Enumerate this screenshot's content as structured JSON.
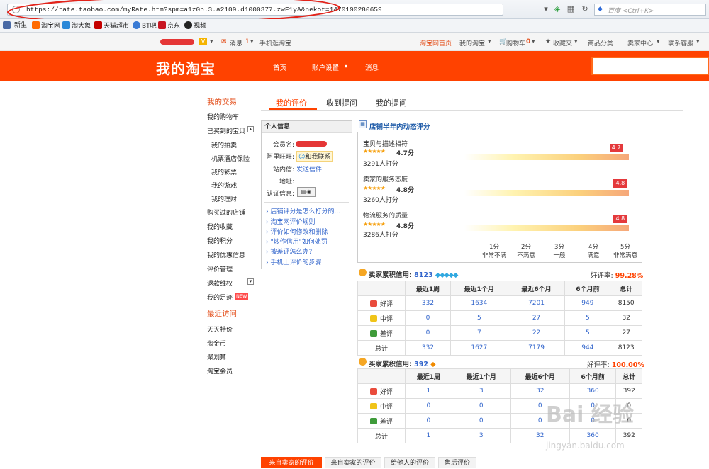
{
  "browser": {
    "url": "https://rate.taobao.com/myRate.htm?spm=a1z0b.3.a2109.d1000377.zwF1yA&nekot=1470190280659",
    "search_placeholder": "百度 <Ctrl+K>"
  },
  "bookmarks": [
    "新生",
    "淘宝网",
    "淘大象",
    "天猫超市",
    "BT吧",
    "京东",
    "视频"
  ],
  "sitenav": {
    "messages": "消息",
    "messages_count": "1",
    "mobile": "手机逛淘宝",
    "home": "淘宝网首页",
    "my_taobao": "我的淘宝",
    "cart": "购物车",
    "cart_count": "0",
    "favorites": "收藏夹",
    "categories": "商品分类",
    "seller_center": "卖家中心",
    "service": "联系客服"
  },
  "header": {
    "logo": "我的淘宝",
    "nav": [
      "首页",
      "账户设置",
      "消息"
    ]
  },
  "sidebar": {
    "section1": "我的交易",
    "items1": [
      "我的购物车",
      "已买到的宝贝",
      "我的拍卖",
      "机票酒店保险",
      "我的彩票",
      "我的游戏",
      "我的理财",
      "购买过的店铺",
      "我的收藏",
      "我的积分",
      "我的优惠信息",
      "评价管理",
      "退款维权",
      "我的足迹"
    ],
    "new_badge": "NEW",
    "section2": "最近访问",
    "items2": [
      "天天特价",
      "淘金币",
      "聚划算",
      "淘宝会员"
    ]
  },
  "tabs": [
    "我的评价",
    "收到提问",
    "我的提问"
  ],
  "info": {
    "title": "个人信息",
    "member_label": "会员名:",
    "wangwang_label": "阿里旺旺:",
    "wangwang_btn": "和我联系",
    "mail_label": "站内信:",
    "mail_link": "发送信件",
    "addr_label": "地址:",
    "cert_label": "认证信息:",
    "faq": [
      "店铺评分是怎么打分的...",
      "淘宝网评价规则",
      "评价如何修改和删除",
      "\"炒作信用\"如何处罚",
      "被差评怎么办?",
      "手机上评价的步骤"
    ]
  },
  "dsr": {
    "title": "店铺半年内动态评分",
    "items": [
      {
        "name": "宝贝与描述相符",
        "score": "4.7分",
        "count": "3291人打分",
        "flag": "4.7",
        "value": 4.7
      },
      {
        "name": "卖家的服务态度",
        "score": "4.8分",
        "count": "3260人打分",
        "flag": "4.8",
        "value": 4.8
      },
      {
        "name": "物流服务的质量",
        "score": "4.8分",
        "count": "3286人打分",
        "flag": "4.8",
        "value": 4.8
      }
    ],
    "axis": [
      {
        "n": "1分",
        "l": "非常不满"
      },
      {
        "n": "2分",
        "l": "不满意"
      },
      {
        "n": "3分",
        "l": "一般"
      },
      {
        "n": "4分",
        "l": "满意"
      },
      {
        "n": "5分",
        "l": "非常满意"
      }
    ]
  },
  "seller_credit": {
    "title": "卖家累积信用:",
    "value": "8123",
    "rate_label": "好评率:",
    "rate": "99.28%",
    "headers": [
      "",
      "最近1周",
      "最近1个月",
      "最近6个月",
      "6个月前",
      "总计"
    ],
    "rows": [
      {
        "label": "好评",
        "cells": [
          "332",
          "1634",
          "7201",
          "949",
          "8150"
        ]
      },
      {
        "label": "中评",
        "cells": [
          "0",
          "5",
          "27",
          "5",
          "32"
        ]
      },
      {
        "label": "差评",
        "cells": [
          "0",
          "7",
          "22",
          "5",
          "27"
        ]
      },
      {
        "label": "总计",
        "cells": [
          "332",
          "1627",
          "7179",
          "944",
          "8123"
        ]
      }
    ]
  },
  "buyer_credit": {
    "title": "买家累积信用:",
    "value": "392",
    "rate_label": "好评率:",
    "rate": "100.00%",
    "headers": [
      "",
      "最近1周",
      "最近1个月",
      "最近6个月",
      "6个月前",
      "总计"
    ],
    "rows": [
      {
        "label": "好评",
        "cells": [
          "1",
          "3",
          "32",
          "360",
          "392"
        ]
      },
      {
        "label": "中评",
        "cells": [
          "0",
          "0",
          "0",
          "0",
          "0"
        ]
      },
      {
        "label": "差评",
        "cells": [
          "0",
          "0",
          "0",
          "0",
          "0"
        ]
      },
      {
        "label": "总计",
        "cells": [
          "1",
          "3",
          "32",
          "360",
          "392"
        ]
      }
    ]
  },
  "bottom_tabs": [
    "来自卖家的评价",
    "来自卖家的评价",
    "给他人的评价",
    "售后评价"
  ],
  "watermark": {
    "main": "Bai 经验",
    "sub": "jingyan.baidu.com"
  }
}
